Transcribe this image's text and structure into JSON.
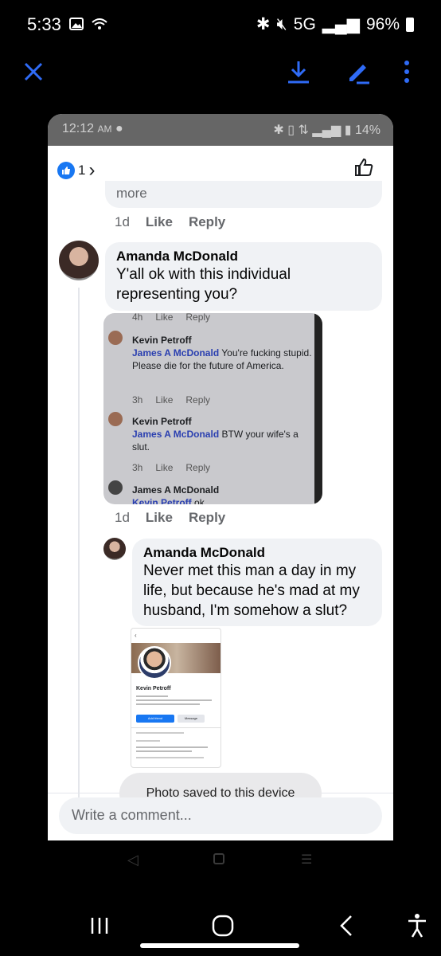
{
  "status": {
    "time": "5:33",
    "network": "5G",
    "battery": "96%"
  },
  "shot_status": {
    "time": "12:12",
    "ampm": "AM",
    "battery": "14%"
  },
  "likes": {
    "count": "1",
    "arrow": "›"
  },
  "prev": {
    "more": "more",
    "age": "1d",
    "like": "Like",
    "reply": "Reply"
  },
  "c1": {
    "name": "Amanda McDonald",
    "text": "Y'all ok with this individual representing you?",
    "age": "1d",
    "like": "Like",
    "reply": "Reply"
  },
  "inner": {
    "top_meta": {
      "age": "4h",
      "like": "Like",
      "reply": "Reply"
    },
    "r1": {
      "name": "Kevin Petroff",
      "link": "James A McDonald",
      "text": " You're fucking stupid. Please die for the future of America.",
      "age": "3h",
      "like": "Like",
      "reply": "Reply"
    },
    "r2": {
      "name": "Kevin Petroff",
      "link": "James A McDonald",
      "text": " BTW your wife's a slut.",
      "age": "3h",
      "like": "Like",
      "reply": "Reply"
    },
    "r3": {
      "name": "James A McDonald",
      "link": "Kevin Petroff",
      "text": " ok"
    }
  },
  "c2": {
    "name": "Amanda McDonald",
    "text": "Never met this man a day in my life, but because he's mad at my husband, I'm somehow a slut?"
  },
  "profile": {
    "name": "Kevin Petroff",
    "add": "Add friend",
    "msg": "Message"
  },
  "toast": "Photo saved to this device",
  "composer": {
    "placeholder": "Write a comment..."
  },
  "colors": {
    "accent": "#1877f2",
    "viewer_blue": "#2f6bf6"
  }
}
